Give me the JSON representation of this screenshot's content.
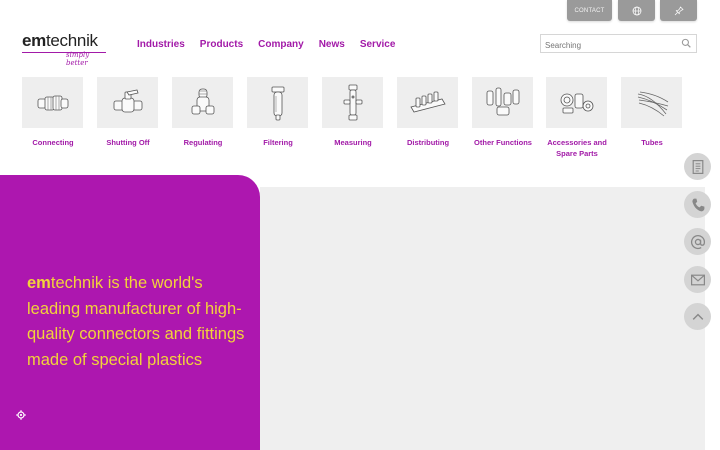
{
  "topbar": {
    "contact_label": "CONTACT",
    "language_icon": "globe-icon",
    "pin_icon": "pin-icon"
  },
  "logo": {
    "brand_bold": "em",
    "brand_rest": "technik",
    "tagline": "simply better"
  },
  "nav": {
    "items": [
      "Industries",
      "Products",
      "Company",
      "News",
      "Service"
    ]
  },
  "search": {
    "placeholder": "Searching",
    "icon": "search-icon"
  },
  "products": [
    {
      "label": "Connecting",
      "icon": "connector-icon"
    },
    {
      "label": "Shutting Off",
      "icon": "valve-icon"
    },
    {
      "label": "Regulating",
      "icon": "regulator-icon"
    },
    {
      "label": "Filtering",
      "icon": "filter-icon"
    },
    {
      "label": "Measuring",
      "icon": "flowmeter-icon"
    },
    {
      "label": "Distributing",
      "icon": "manifold-icon"
    },
    {
      "label": "Other Functions",
      "icon": "fittings-icon"
    },
    {
      "label": "Accessories and Spare Parts",
      "icon": "accessories-icon"
    },
    {
      "label": "Tubes",
      "icon": "tubes-icon"
    }
  ],
  "hero": {
    "brand_bold": "em",
    "text": "technik is the world's leading manufacturer of high-quality connectors and fittings made of special plastics"
  },
  "colors": {
    "brand": "#ad17af",
    "accent_text": "#f2d33a",
    "nav": "#a21aa8"
  },
  "side_actions": [
    "document-icon",
    "phone-icon",
    "at-icon",
    "mail-icon",
    "arrow-up-icon"
  ]
}
